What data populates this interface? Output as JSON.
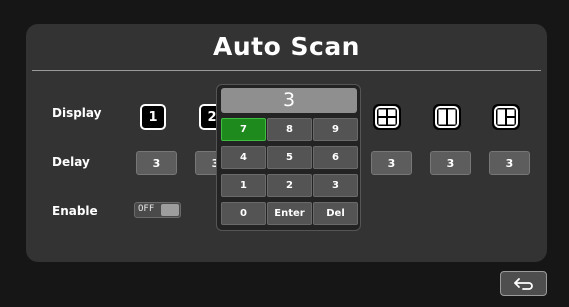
{
  "page": {
    "title": "Auto Scan"
  },
  "rows": {
    "display_label": "Display",
    "delay_label": "Delay",
    "enable_label": "Enable"
  },
  "display": {
    "channels": [
      "1",
      "2"
    ],
    "layout_icons": [
      "quad-layout-icon",
      "dual-layout-icon",
      "triple-layout-icon"
    ]
  },
  "delay": {
    "values": [
      "3",
      "3",
      "3",
      "3",
      "3"
    ]
  },
  "enable": {
    "state": "OFF"
  },
  "keypad": {
    "display_value": "3",
    "keys": [
      "7",
      "8",
      "9",
      "4",
      "5",
      "6",
      "1",
      "2",
      "3",
      "0",
      "Enter",
      "Del"
    ],
    "selected_key": "7"
  },
  "footer": {
    "back_icon": "return-arrow-icon"
  },
  "colors": {
    "background": "#161616",
    "panel": "#333333",
    "selected_key": "#1e8a1e",
    "button": "#5d5d5d"
  }
}
